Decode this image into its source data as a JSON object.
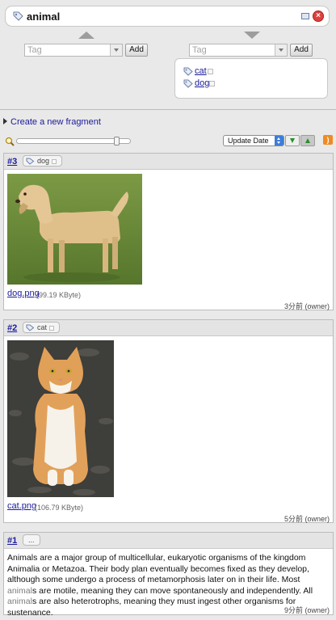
{
  "header": {
    "title": "animal"
  },
  "left_tag": {
    "placeholder": "Tag",
    "add_label": "Add"
  },
  "right_tag": {
    "placeholder": "Tag",
    "add_label": "Add",
    "tags": [
      "cat",
      "dog"
    ]
  },
  "create_link": "Create a new fragment",
  "sort": {
    "selected": "Update Date"
  },
  "cards": [
    {
      "id": "#3",
      "tag": "dog",
      "file_name": "dog.png",
      "file_size": "(99.19 KByte)",
      "time": "3分前",
      "owner": "(owner)"
    },
    {
      "id": "#2",
      "tag": "cat",
      "file_name": "cat.png",
      "file_size": "(106.79 KByte)",
      "time": "5分前",
      "owner": "(owner)"
    },
    {
      "id": "#1",
      "tag": "...",
      "text_parts": [
        "Animals are a major group of multicellular, eukaryotic organisms of the kingdom Animalia or Metazoa. Their body plan eventually becomes fixed as they develop, although some undergo a process of metamorphosis later on in their life. Most ",
        "animal",
        "s are motile, meaning they can move spontaneously and independently. All ",
        "animal",
        "s are also heterotrophs, meaning they must ingest other organisms for sustenance."
      ],
      "time": "9分前",
      "owner": "(owner)"
    }
  ],
  "colors": {
    "link": "#1a1a9a",
    "rss": "#f08a24",
    "close": "#e04040",
    "sort_arrow": "#2a8e2a"
  }
}
